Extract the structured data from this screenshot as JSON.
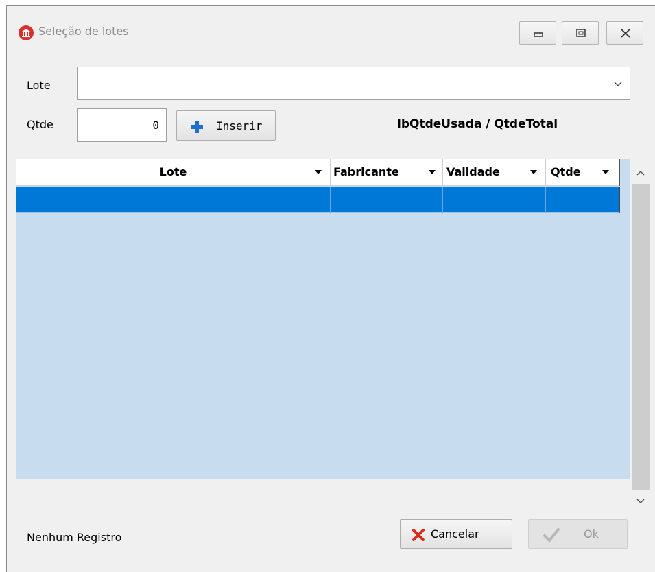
{
  "window": {
    "title": "Seleção de lotes",
    "icon": "bank-icon",
    "controls": [
      "minimize-icon",
      "maximize-icon",
      "close-icon"
    ]
  },
  "form": {
    "lote_label": "Lote",
    "lote_value": "",
    "qtde_label": "Qtde",
    "qtde_value": "0",
    "insert_label": "Inserir",
    "qtde_info": "lbQtdeUsada / QtdeTotal"
  },
  "grid": {
    "columns": [
      "Lote",
      "Fabricante",
      "Validade",
      "Qtde"
    ],
    "rows": [
      {
        "lote": "",
        "fabricante": "",
        "validade": "",
        "qtde": ""
      }
    ],
    "selected_row_color": "#0078d7",
    "background_color": "#c8dcf0"
  },
  "footer": {
    "status": "Nenhum Registro",
    "cancel_label": "Cancelar",
    "ok_label": "Ok"
  },
  "colors": {
    "accent": "#0078d7",
    "cancel_icon": "#d92a1c",
    "plus_icon": "#1f6fd1",
    "app_icon": "#d9302c"
  }
}
